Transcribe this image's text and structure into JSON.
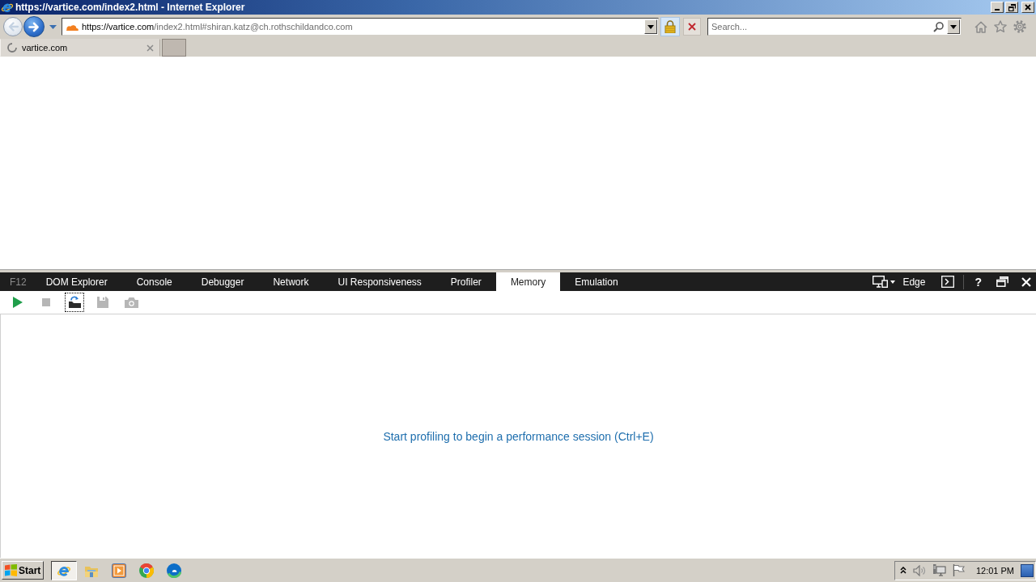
{
  "window": {
    "title": "https://vartice.com/index2.html - Internet Explorer"
  },
  "address_bar": {
    "url_domain": "https://vartice.com",
    "url_path": "/index2.html#shiran.katz@ch.rothschildandco.com",
    "secure": true
  },
  "search": {
    "placeholder": "Search..."
  },
  "tabs": [
    {
      "label": "vartice.com",
      "selected": true,
      "loading": true
    }
  ],
  "devtools": {
    "label": "F12",
    "tabs": [
      {
        "label": "DOM Explorer",
        "selected": false
      },
      {
        "label": "Console",
        "selected": false
      },
      {
        "label": "Debugger",
        "selected": false
      },
      {
        "label": "Network",
        "selected": false
      },
      {
        "label": "UI Responsiveness",
        "selected": false
      },
      {
        "label": "Profiler",
        "selected": false
      },
      {
        "label": "Memory",
        "selected": true
      },
      {
        "label": "Emulation",
        "selected": false
      }
    ],
    "document_mode": "Edge",
    "help": "?",
    "toolbar": [
      {
        "kind": "play",
        "disabled": false,
        "focused": false
      },
      {
        "kind": "stop",
        "disabled": true,
        "focused": false
      },
      {
        "kind": "import",
        "disabled": false,
        "focused": true
      },
      {
        "kind": "save",
        "disabled": true,
        "focused": false
      },
      {
        "kind": "screenshot",
        "disabled": true,
        "focused": false
      }
    ],
    "message": "Start profiling to begin a performance session (Ctrl+E)"
  },
  "taskbar": {
    "start": "Start",
    "apps": [
      {
        "kind": "ie",
        "selected": true
      },
      {
        "kind": "explorer",
        "selected": false
      },
      {
        "kind": "media",
        "selected": false
      },
      {
        "kind": "chrome",
        "selected": false
      },
      {
        "kind": "edge",
        "selected": false
      }
    ],
    "clock": "12:01 PM"
  }
}
